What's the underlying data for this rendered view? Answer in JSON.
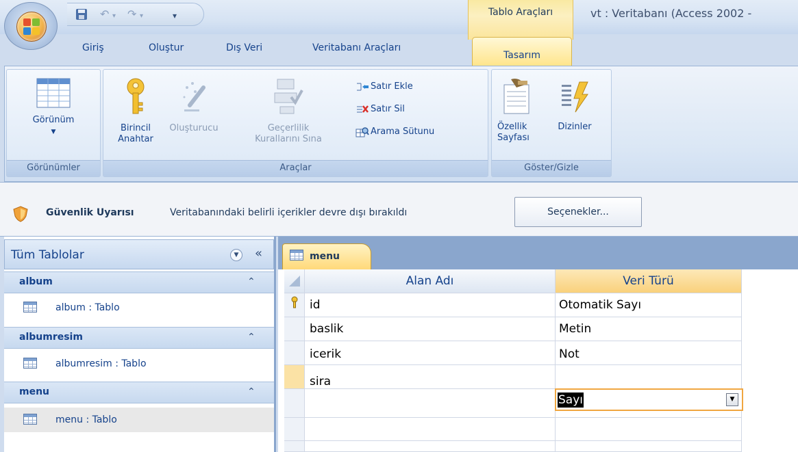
{
  "window": {
    "context_group_label": "Tablo Araçları",
    "title": "vt : Veritabanı (Access 2002 -"
  },
  "tabs": [
    "Giriş",
    "Oluştur",
    "Dış Veri",
    "Veritabanı Araçları"
  ],
  "active_tab": "Tasarım",
  "ribbon": {
    "views": {
      "view_button": "Görünüm",
      "group_label": "Görünümler"
    },
    "tools": {
      "primary_key_line1": "Birincil",
      "primary_key_line2": "Anahtar",
      "builder": "Oluşturucu",
      "validation_line1": "Geçerlilik",
      "validation_line2": "Kurallarını Sına",
      "insert_row": "Satır Ekle",
      "delete_row": "Satır Sil",
      "lookup_column": "Arama Sütunu",
      "group_label": "Araçlar"
    },
    "show_hide": {
      "property_sheet_line1": "Özellik",
      "property_sheet_line2": "Sayfası",
      "indexes": "Dizinler",
      "group_label": "Göster/Gizle"
    }
  },
  "security_bar": {
    "title": "Güvenlik Uyarısı",
    "message": "Veritabanındaki belirli içerikler devre dışı bırakıldı",
    "options_button": "Seçenekler..."
  },
  "nav_pane": {
    "title": "Tüm Tablolar",
    "groups": [
      {
        "name": "album",
        "items": [
          "album : Tablo"
        ]
      },
      {
        "name": "albumresim",
        "items": [
          "albumresim : Tablo"
        ]
      },
      {
        "name": "menu",
        "items": [
          "menu : Tablo"
        ]
      }
    ],
    "selected_item": "menu : Tablo"
  },
  "document": {
    "tab_label": "menu",
    "columns": [
      "Alan Adı",
      "Veri Türü"
    ],
    "rows": [
      {
        "field": "id",
        "type": "Otomatik Sayı",
        "primary_key": true
      },
      {
        "field": "baslik",
        "type": "Metin",
        "primary_key": false
      },
      {
        "field": "icerik",
        "type": "Not",
        "primary_key": false
      },
      {
        "field": "sira",
        "type": "Sayı",
        "primary_key": false
      }
    ],
    "selected_row": 3
  },
  "colors": {
    "accent": "#ffd97a",
    "selection_border": "#f0a640",
    "frame": "#8aa6cd"
  },
  "icons": [
    "office-button-icon",
    "save-icon",
    "undo-icon",
    "redo-icon",
    "customize-qat-icon",
    "view-icon",
    "primary-key-icon",
    "builder-icon",
    "validation-icon",
    "insert-row-icon",
    "delete-row-icon",
    "lookup-column-icon",
    "property-sheet-icon",
    "indexes-icon",
    "shield-icon",
    "table-icon",
    "key-icon",
    "dropdown-arrow-icon"
  ]
}
